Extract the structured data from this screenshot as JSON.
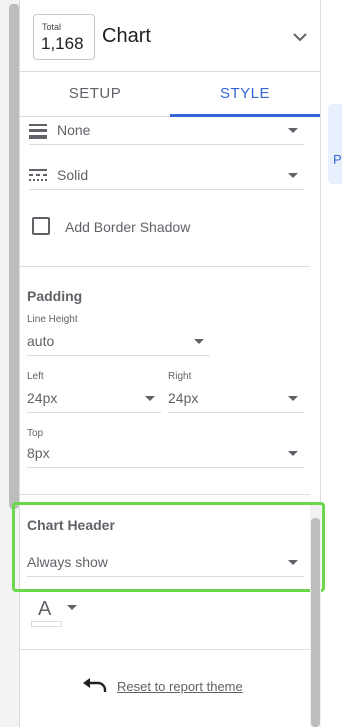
{
  "chart_header": {
    "scorecard_label": "Total",
    "scorecard_value": "1,168",
    "title": "Chart"
  },
  "tabs": [
    {
      "label": "SETUP",
      "active": false
    },
    {
      "label": "STYLE",
      "active": true
    }
  ],
  "border": {
    "weight_value": "None",
    "style_value": "Solid",
    "shadow_label": "Add Border Shadow",
    "shadow_checked": false
  },
  "padding": {
    "title": "Padding",
    "line_height_label": "Line Height",
    "line_height_value": "auto",
    "left_label": "Left",
    "left_value": "24px",
    "right_label": "Right",
    "right_value": "24px",
    "top_label": "Top",
    "top_value": "8px"
  },
  "chart_header_section": {
    "title": "Chart Header",
    "value": "Always show"
  },
  "text_color": {
    "glyph": "A"
  },
  "reset": {
    "label": "Reset to report theme"
  },
  "side_panel": {
    "label": "P"
  },
  "colors": {
    "accent": "#3367d6",
    "highlight": "#6ad84a",
    "text": "#5f6368",
    "divider": "#dadce0"
  }
}
